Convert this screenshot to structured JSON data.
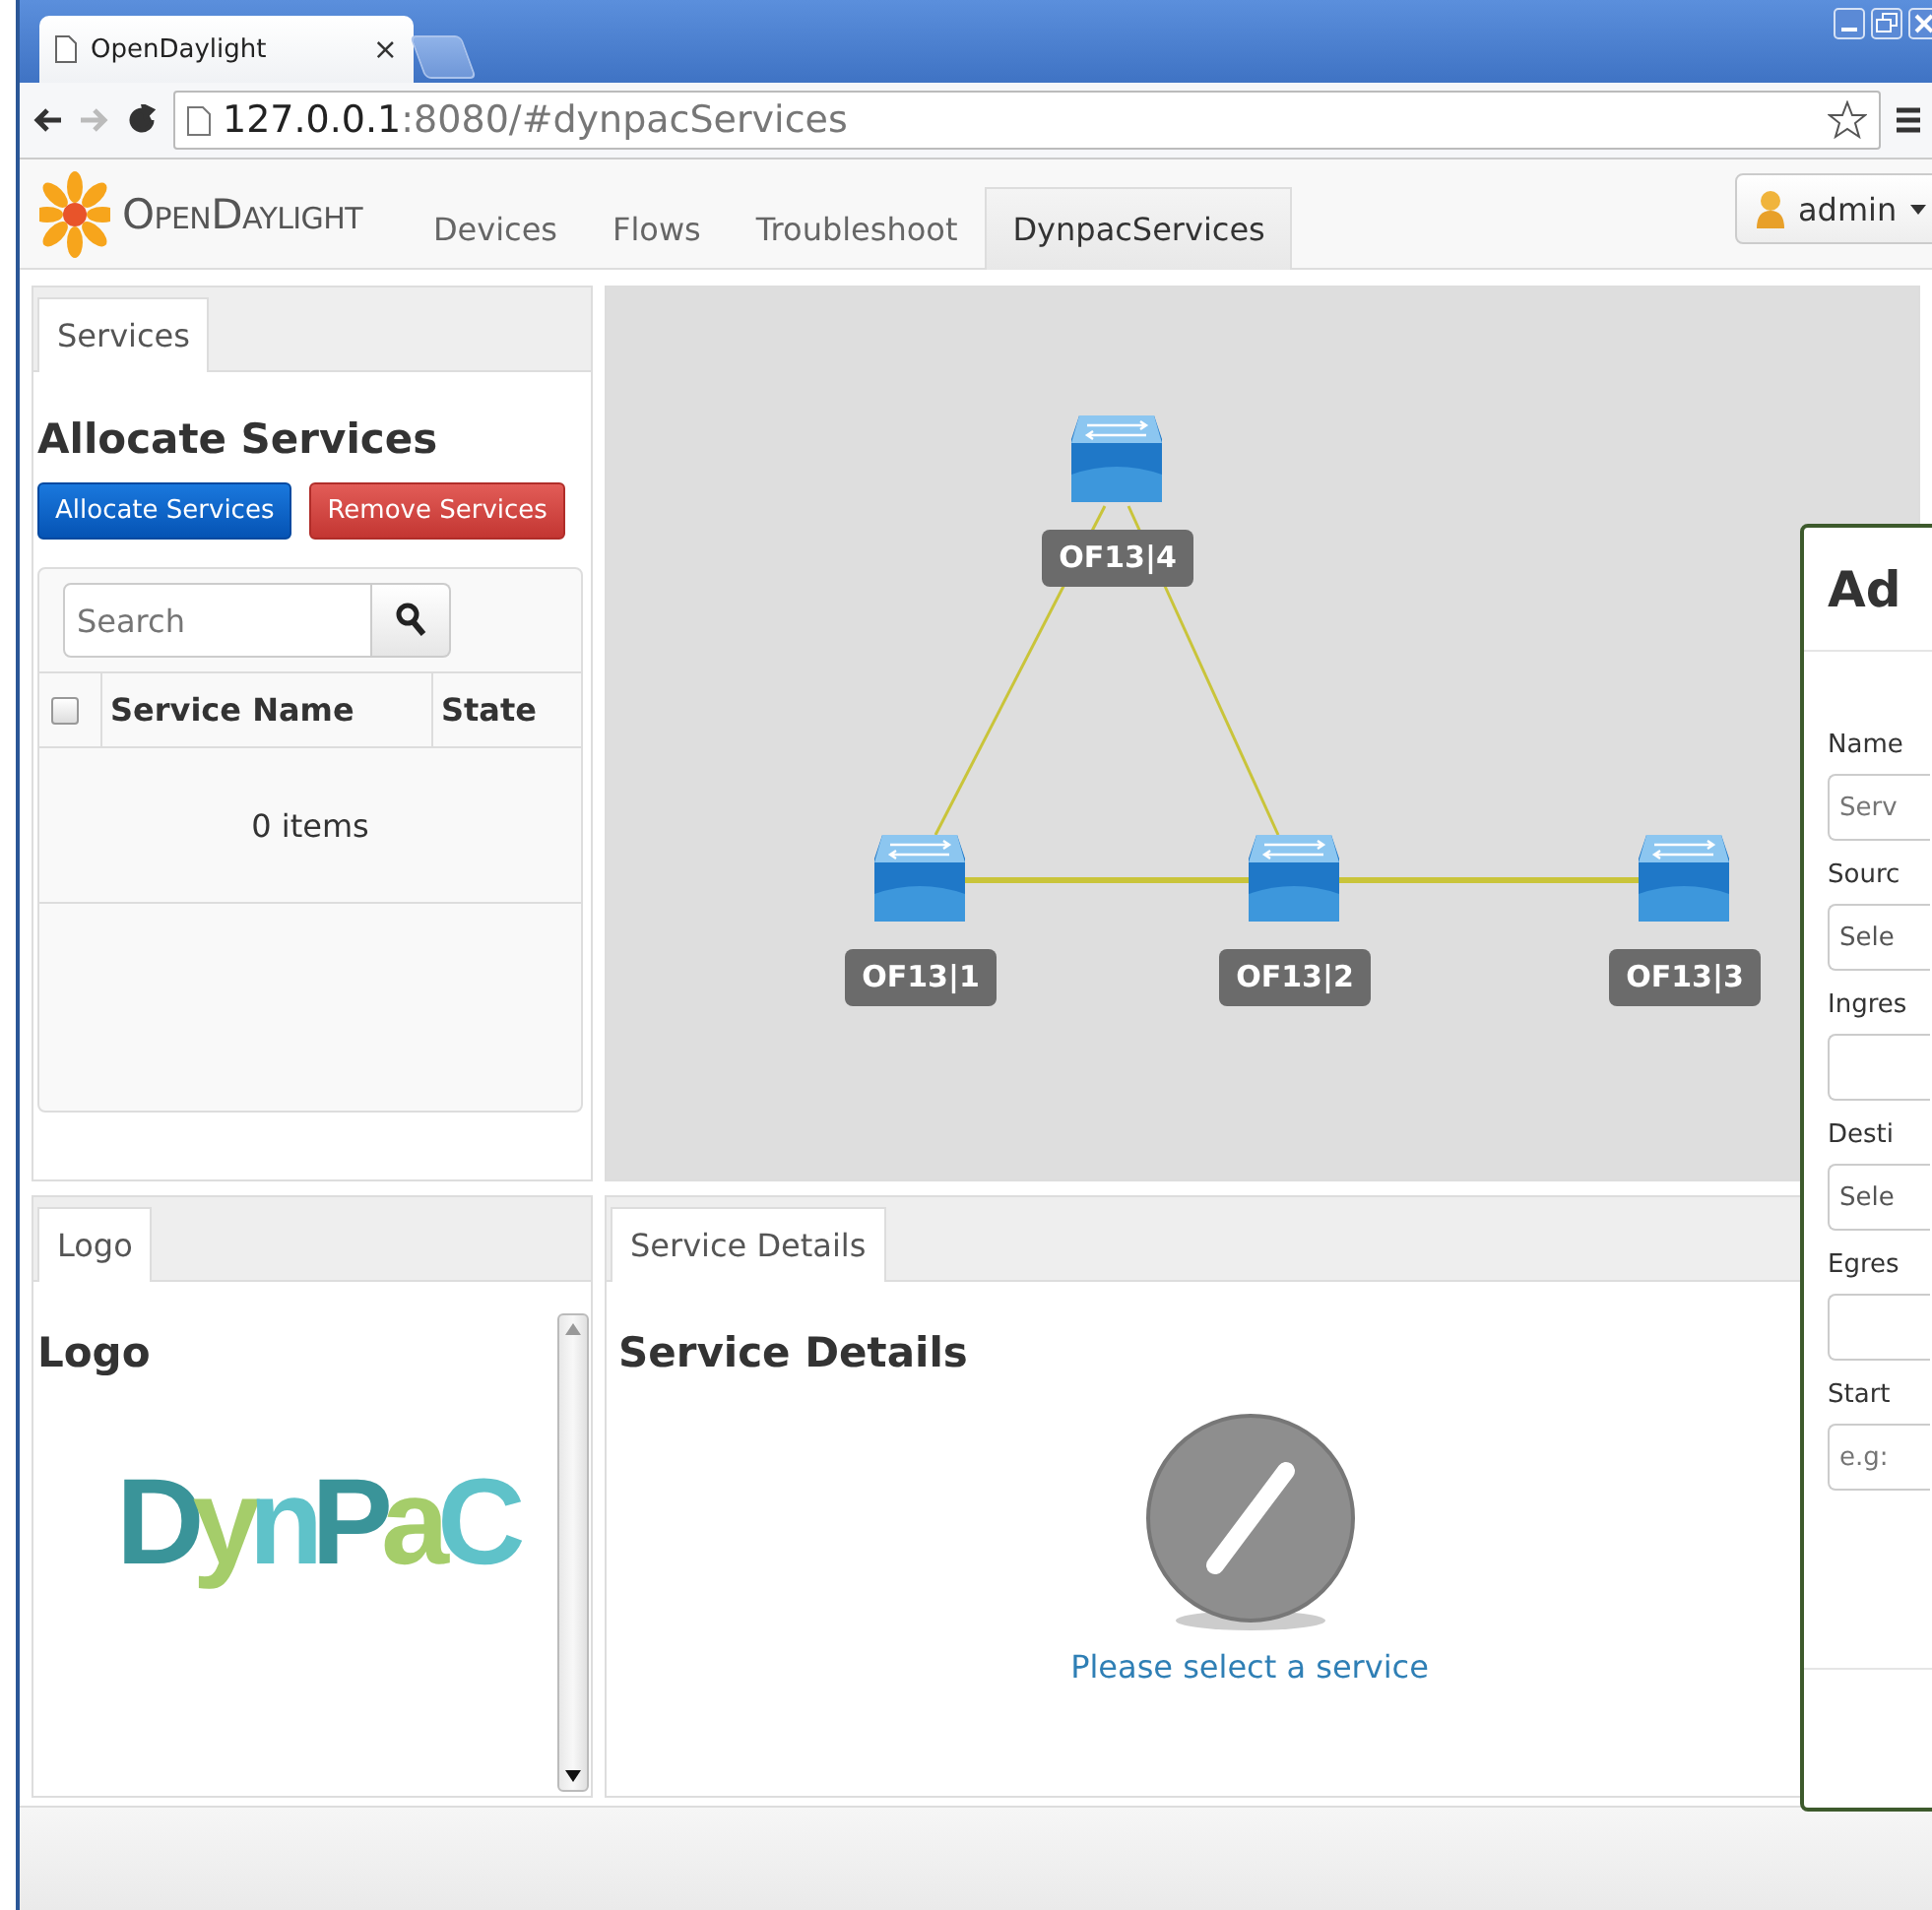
{
  "browser": {
    "tab_title": "OpenDaylight",
    "tab_close": "×",
    "url_host": "127.0.0.1",
    "url_rest": ":8080/#dynpacServices"
  },
  "navbar": {
    "brand": "OpenDaylight",
    "tabs": [
      {
        "label": "Devices",
        "selected": false
      },
      {
        "label": "Flows",
        "selected": false
      },
      {
        "label": "Troubleshoot",
        "selected": false
      },
      {
        "label": "DynpacServices",
        "selected": true
      }
    ],
    "user": "admin"
  },
  "services_panel": {
    "tab": "Services",
    "heading": "Allocate Services",
    "buttons": [
      {
        "label": "Allocate Services",
        "kind": "primary"
      },
      {
        "label": "Remove Services",
        "kind": "danger"
      }
    ],
    "search": {
      "placeholder": "Search"
    },
    "select_all": {
      "checked": false
    },
    "columns": [
      "Service Name",
      "State"
    ],
    "footer": "0 items"
  },
  "topology": {
    "nodes": [
      {
        "label": "OF13|4"
      },
      {
        "label": "OF13|1"
      },
      {
        "label": "OF13|2"
      },
      {
        "label": "OF13|3"
      }
    ]
  },
  "logo_panel": {
    "tab": "Logo",
    "heading": "Logo",
    "logo": "DynPaC"
  },
  "details_panel": {
    "tab": "Service Details",
    "heading": "Service Details",
    "message": "Please select a service"
  },
  "modal": {
    "title": "Ad",
    "fields": [
      {
        "label": "Name",
        "kind": "input",
        "placeholder": "Serv"
      },
      {
        "label": "Sourc",
        "kind": "select",
        "value": "Sele"
      },
      {
        "label": "Ingres",
        "kind": "input"
      },
      {
        "label": "Desti",
        "kind": "select",
        "value": "Sele"
      },
      {
        "label": "Egres",
        "kind": "input"
      },
      {
        "label": "Start",
        "kind": "input",
        "placeholder": "e.g:"
      }
    ]
  }
}
